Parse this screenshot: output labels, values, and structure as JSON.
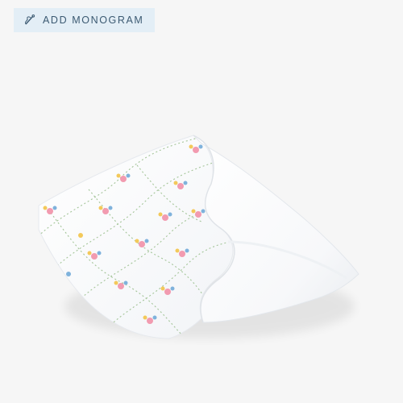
{
  "monogram": {
    "label": "ADD MONOGRAM",
    "icon": "needle-thread-icon"
  },
  "product": {
    "image_subject": "blanket-floral-print",
    "colors": {
      "background": "#f6f6f6",
      "fabric": "#ffffff",
      "vine": "#9bbf8e",
      "flower_pink": "#f29bb0",
      "flower_yellow": "#f3c95a",
      "flower_blue": "#7fb2dc",
      "pill_bg": "#e3eef6",
      "pill_text": "#3c5a72"
    }
  }
}
